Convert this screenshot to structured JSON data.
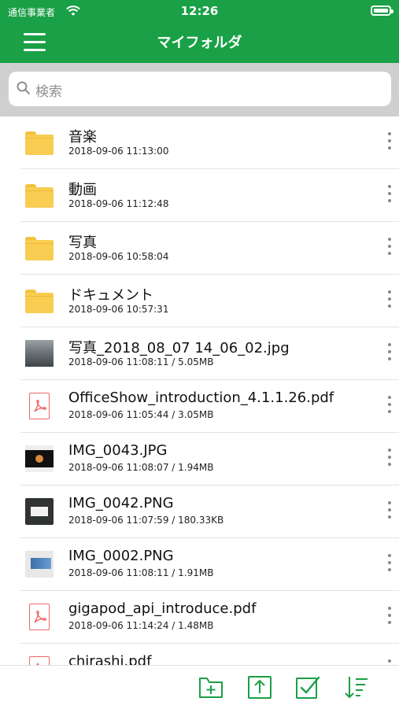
{
  "status": {
    "carrier": "通信事業者",
    "time": "12:26"
  },
  "nav": {
    "title": "マイフォルダ"
  },
  "search": {
    "placeholder": "検索"
  },
  "items": [
    {
      "type": "folder",
      "name": "音楽",
      "meta": "2018-09-06 11:13:00"
    },
    {
      "type": "folder",
      "name": "動画",
      "meta": "2018-09-06 11:12:48"
    },
    {
      "type": "folder",
      "name": "写真",
      "meta": "2018-09-06 10:58:04"
    },
    {
      "type": "folder",
      "name": "ドキュメント",
      "meta": "2018-09-06 10:57:31"
    },
    {
      "type": "image",
      "name": "写真_2018_08_07 14_06_02.jpg",
      "meta": "2018-09-06 11:08:11 / 5.05MB"
    },
    {
      "type": "pdf",
      "name": "OfficeShow_introduction_4.1.1.26.pdf",
      "meta": "2018-09-06 11:05:44 / 3.05MB"
    },
    {
      "type": "image",
      "name": "IMG_0043.JPG",
      "meta": "2018-09-06 11:08:07 / 1.94MB"
    },
    {
      "type": "image",
      "name": "IMG_0042.PNG",
      "meta": "2018-09-06 11:07:59 / 180.33KB"
    },
    {
      "type": "image",
      "name": "IMG_0002.PNG",
      "meta": "2018-09-06 11:08:11 / 1.91MB"
    },
    {
      "type": "pdf",
      "name": "gigapod_api_introduce.pdf",
      "meta": "2018-09-06 11:14:24 / 1.48MB"
    },
    {
      "type": "pdf",
      "name": "chirashi.pdf",
      "meta": ""
    }
  ],
  "colors": {
    "accent": "#1aa046",
    "folder": "#f8cd52",
    "pdf": "#e66666"
  },
  "toolbar_icons": [
    "new-folder-icon",
    "upload-icon",
    "select-icon",
    "sort-icon"
  ]
}
